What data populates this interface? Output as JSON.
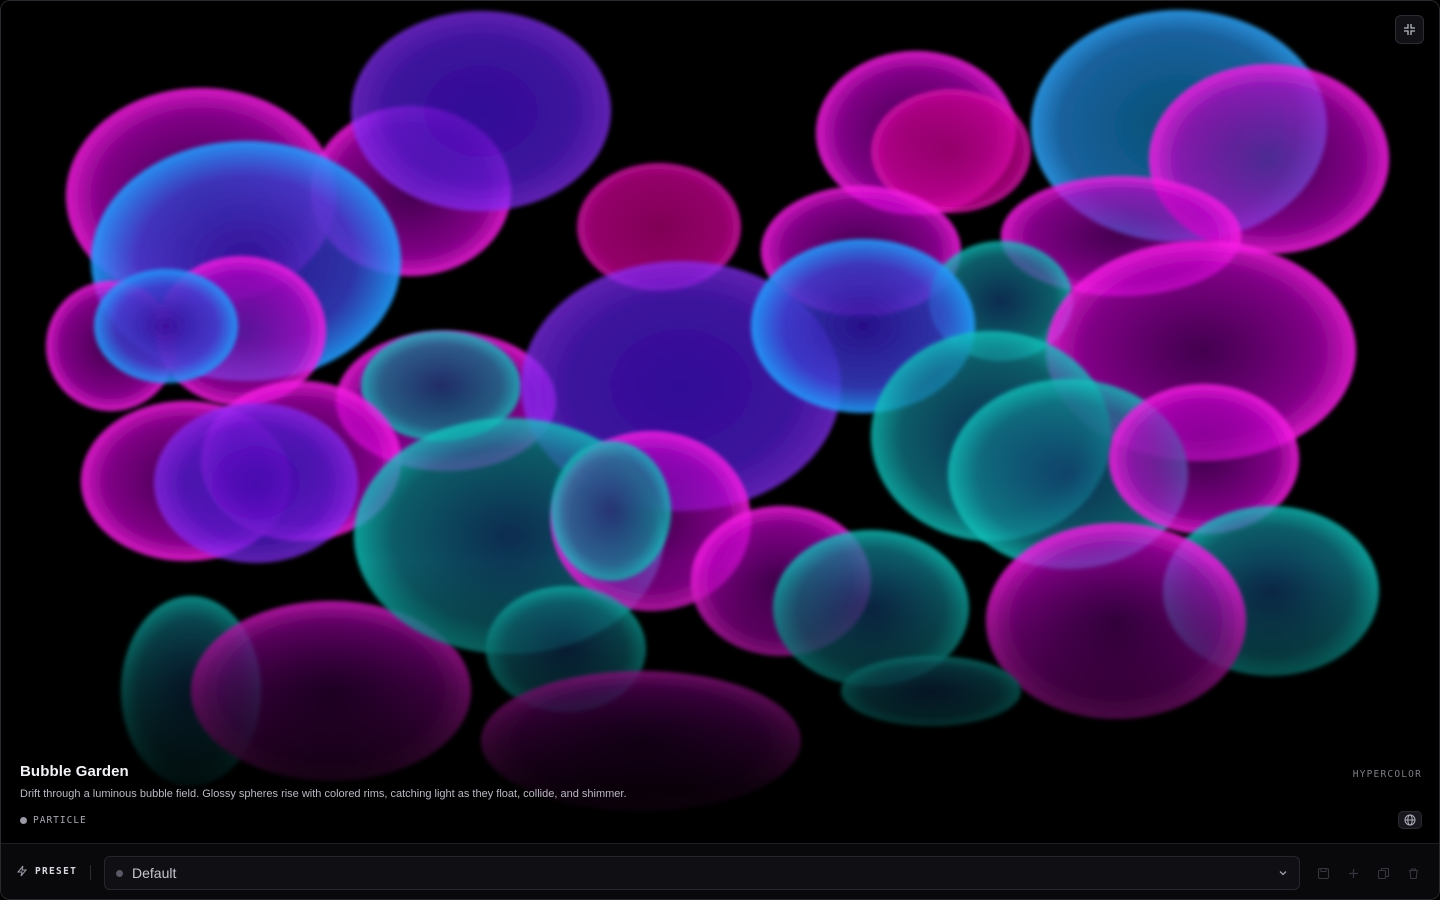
{
  "scene": {
    "title": "Bubble Garden",
    "description": "Drift through a luminous bubble field. Glossy spheres rise with colored rims, catching light as they float, collide, and shimmer.",
    "brand": "HYPERCOLOR",
    "category": "PARTICLE"
  },
  "toolbar": {
    "preset_label": "PRESET",
    "preset_value": "Default"
  },
  "colors": {
    "magenta": "#d000c8",
    "violet": "#6a18d8",
    "blue": "#1a78e8",
    "teal": "#00a8a8",
    "background": "#000000"
  },
  "icons": {
    "fullscreen": "collapse-icon",
    "globe": "globe-icon",
    "preset": "lightning-icon",
    "chevron": "chevron-down-icon",
    "tools": [
      "save-icon",
      "plus-icon",
      "copy-icon",
      "trash-icon"
    ]
  }
}
